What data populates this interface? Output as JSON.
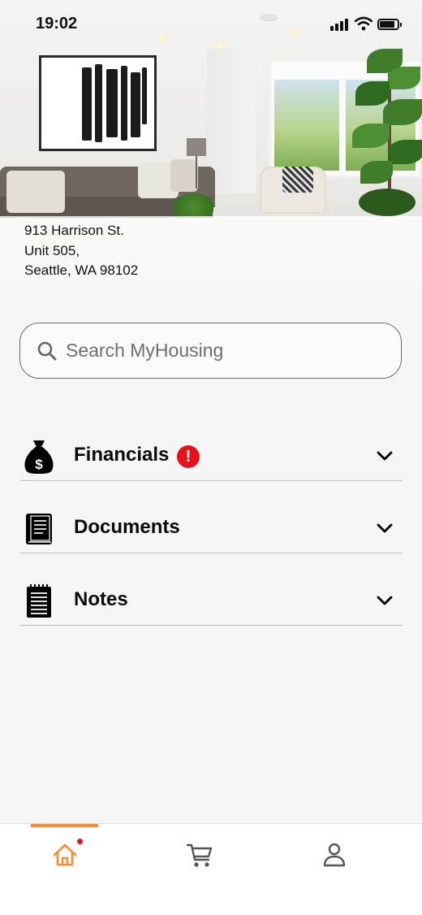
{
  "status_bar": {
    "time": "19:02"
  },
  "property": {
    "address_line1": "913 Harrison St.",
    "address_line2": "Unit 505,",
    "address_line3": "Seattle, WA 98102"
  },
  "search": {
    "placeholder": "Search MyHousing",
    "value": ""
  },
  "sections": [
    {
      "label": "Financials",
      "icon": "money-bag-icon",
      "alert": "!"
    },
    {
      "label": "Documents",
      "icon": "book-icon"
    },
    {
      "label": "Notes",
      "icon": "notepad-icon"
    }
  ],
  "bottom_nav": {
    "items": [
      {
        "icon": "home-icon",
        "active": true,
        "has_notification": true
      },
      {
        "icon": "cart-icon",
        "active": false
      },
      {
        "icon": "profile-icon",
        "active": false
      }
    ]
  },
  "colors": {
    "accent": "#f58d2e",
    "alert": "#e8101b",
    "background": "#f5f5f5"
  }
}
